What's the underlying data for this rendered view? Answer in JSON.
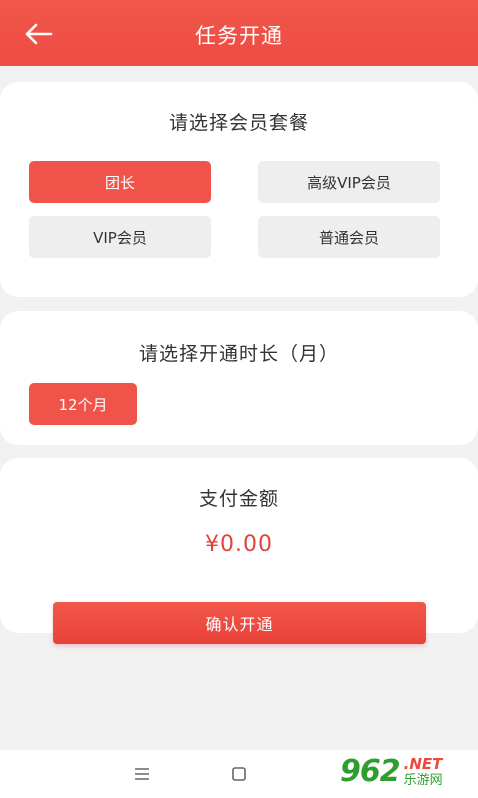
{
  "header": {
    "title": "任务开通"
  },
  "membership": {
    "title": "请选择会员套餐",
    "options": [
      {
        "label": "团长",
        "selected": true
      },
      {
        "label": "高级VIP会员",
        "selected": false
      },
      {
        "label": "VIP会员",
        "selected": false
      },
      {
        "label": "普通会员",
        "selected": false
      }
    ]
  },
  "duration": {
    "title": "请选择开通时长（月）",
    "options": [
      {
        "label": "12个月",
        "selected": true
      }
    ]
  },
  "payment": {
    "title": "支付金额",
    "amount": "¥0.00"
  },
  "confirm_label": "确认开通",
  "watermark": {
    "logo": "962",
    "net": ".NET",
    "sub": "乐游网"
  },
  "colors": {
    "accent": "#f0534a",
    "price": "#e2433a",
    "option_bg": "#eeeeef",
    "page_bg": "#f1f1f2"
  },
  "icons": [
    "back-arrow-icon",
    "menu-icon",
    "home-square-icon"
  ]
}
